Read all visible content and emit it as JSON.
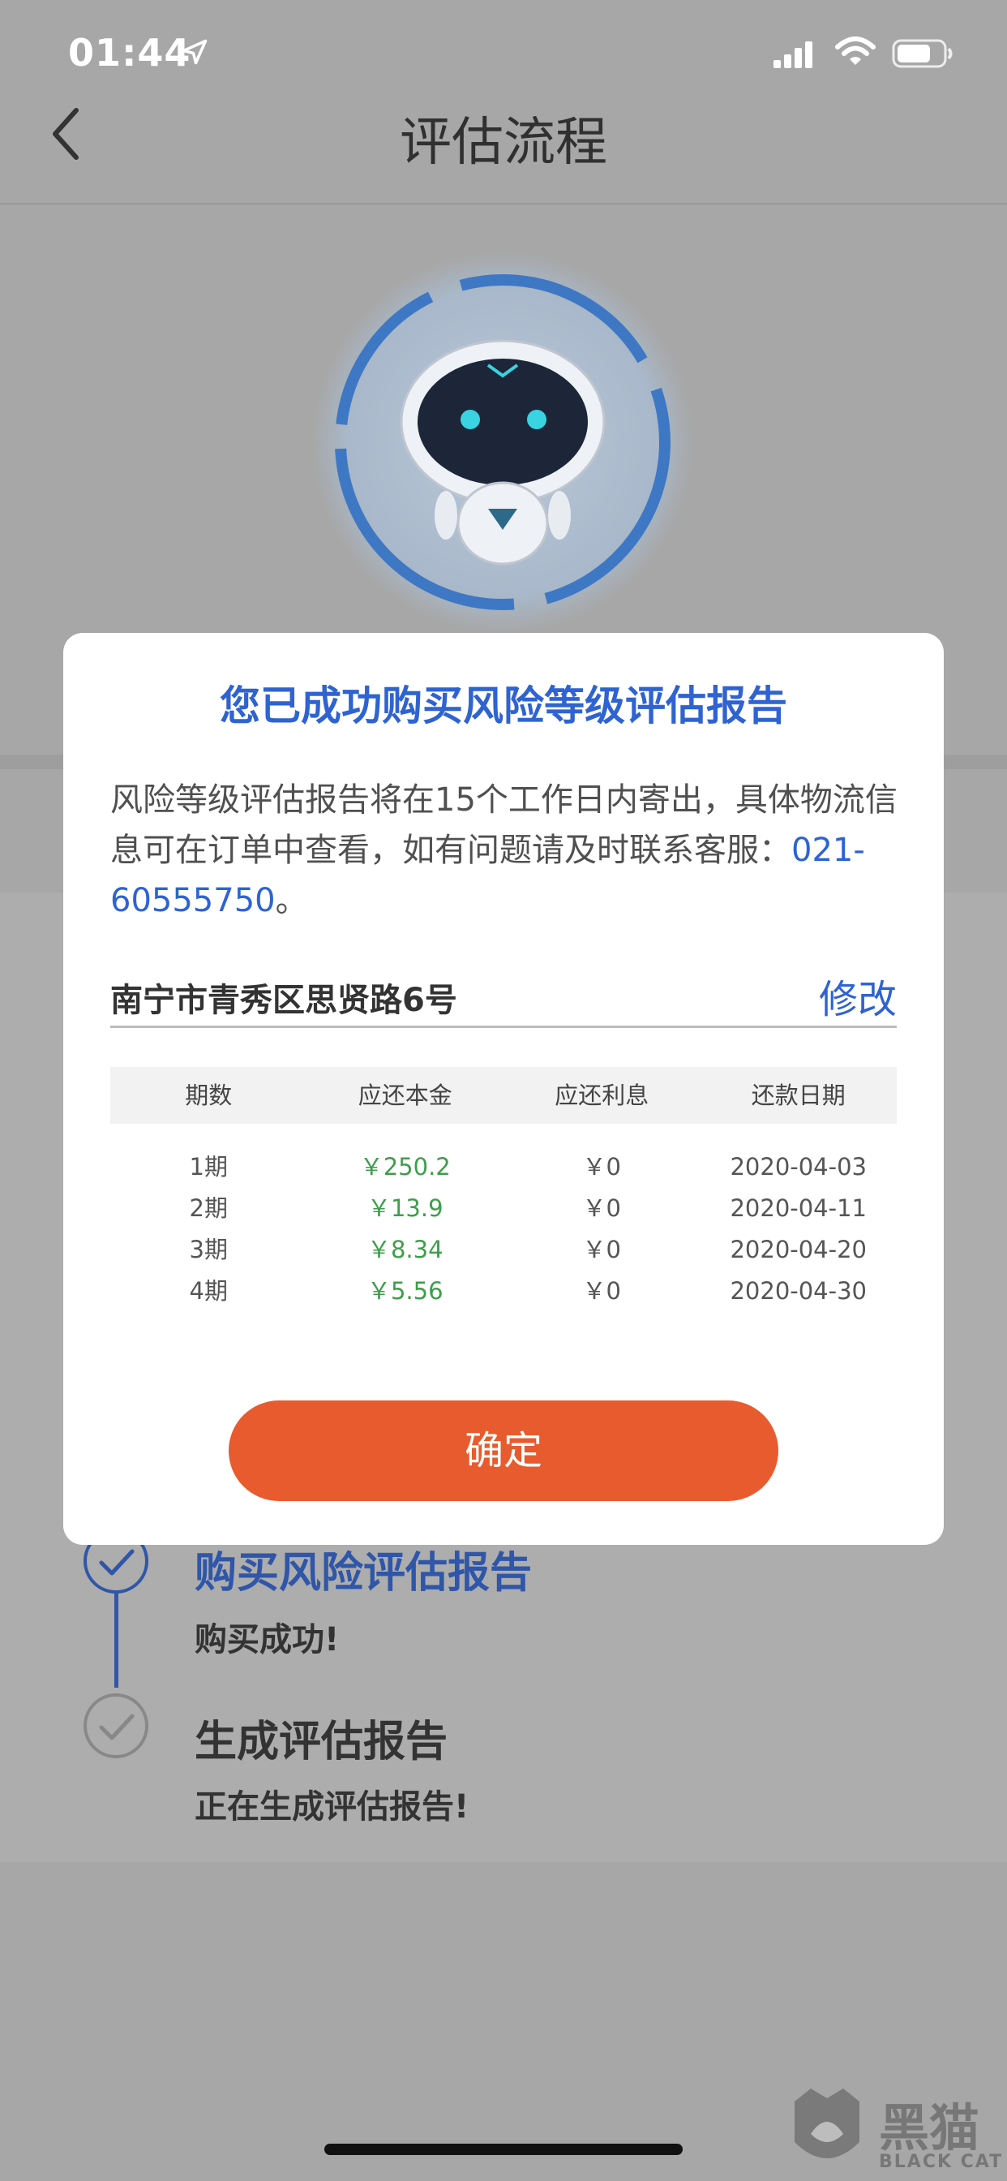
{
  "status_bar": {
    "time": "01:44"
  },
  "nav": {
    "title": "评估流程"
  },
  "steps": [
    {
      "title": "购买风险评估报告",
      "desc": "购买成功!"
    },
    {
      "title": "生成评估报告",
      "desc": "正在生成评估报告!"
    }
  ],
  "modal": {
    "title": "您已成功购买风险等级评估报告",
    "body_text": "风险等级评估报告将在15个工作日内寄出，具体物流信息可在订单中查看，如有问题请及时联系客服：",
    "phone": "021-60555750",
    "body_end": "。",
    "address": "南宁市青秀区思贤路6号",
    "edit_label": "修改",
    "table": {
      "headers": [
        "期数",
        "应还本金",
        "应还利息",
        "还款日期"
      ],
      "rows": [
        [
          "1期",
          "￥250.2",
          "￥0",
          "2020-04-03"
        ],
        [
          "2期",
          "￥13.9",
          "￥0",
          "2020-04-11"
        ],
        [
          "3期",
          "￥8.34",
          "￥0",
          "2020-04-20"
        ],
        [
          "4期",
          "￥5.56",
          "￥0",
          "2020-04-30"
        ]
      ]
    },
    "confirm_label": "确定"
  },
  "watermark": {
    "text": "黑猫",
    "sub": "BLACK CAT"
  },
  "colors": {
    "accent_blue": "#2f63d2",
    "confirm_orange": "#e85b2e",
    "amount_green": "#3e9e4a"
  }
}
